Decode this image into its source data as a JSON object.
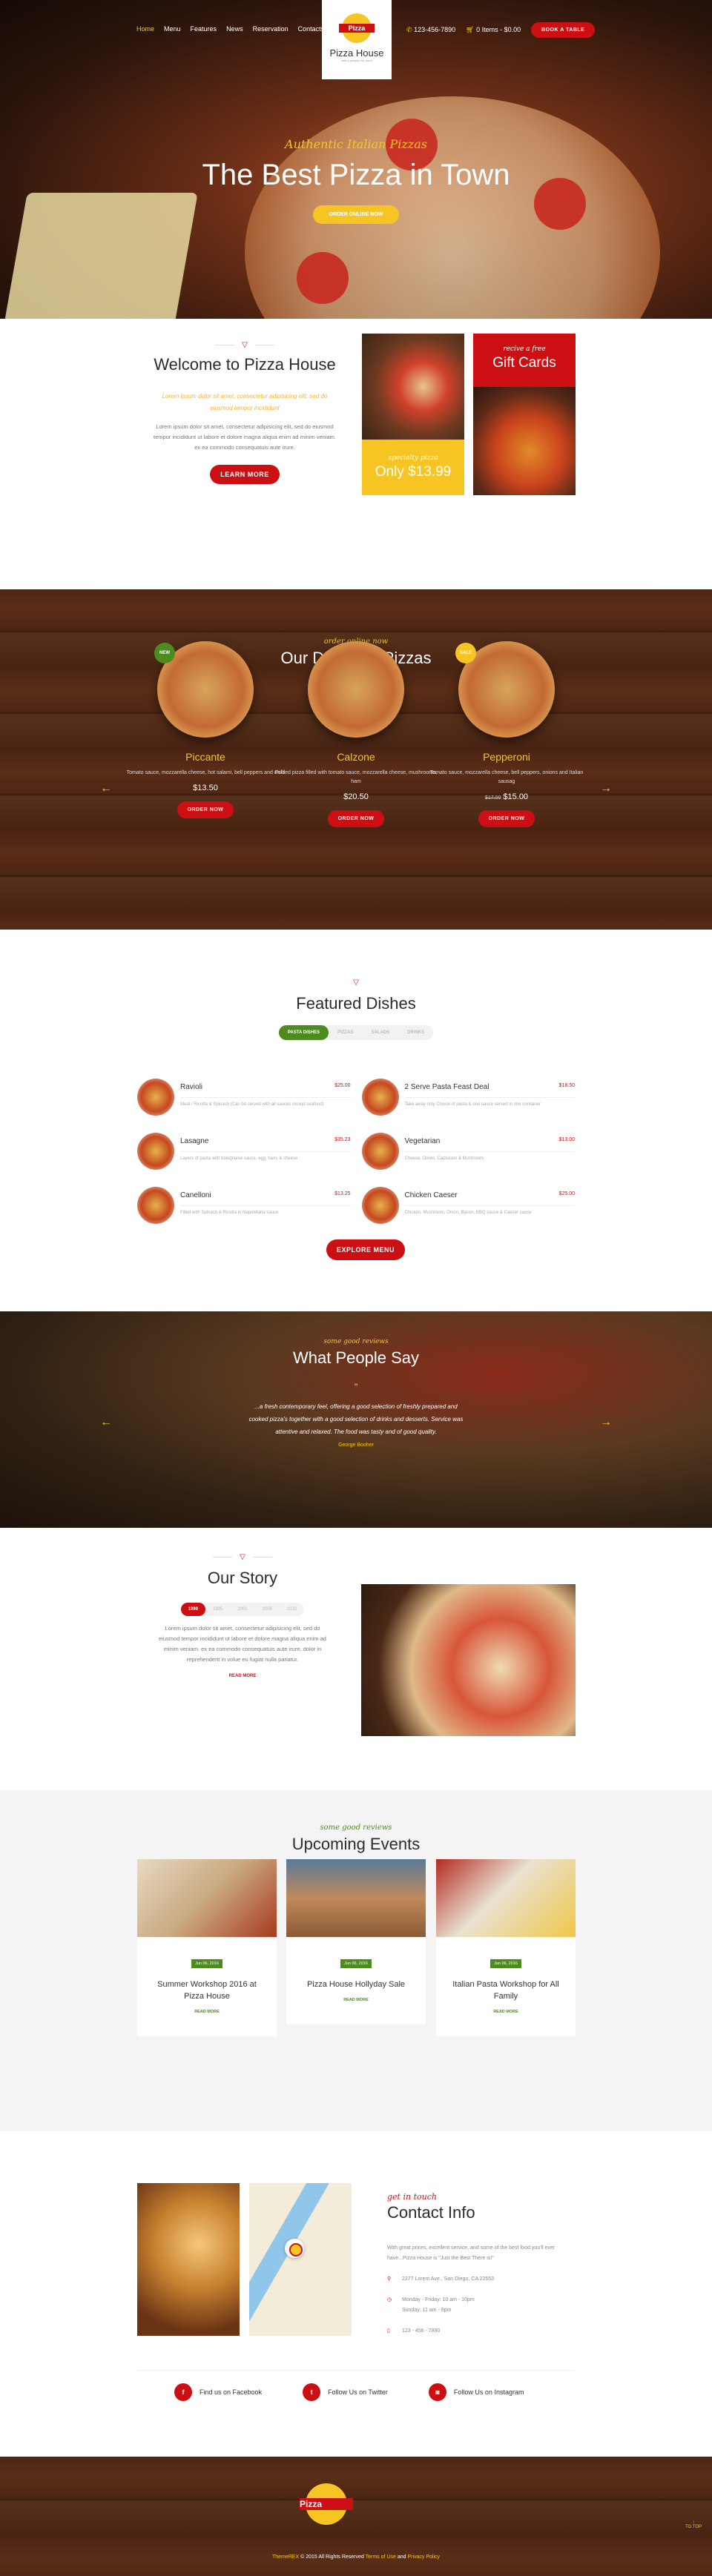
{
  "header": {
    "nav": [
      "Home",
      "Menu",
      "Features",
      "News",
      "Reservation",
      "Contacts"
    ],
    "active_nav": "Home",
    "logo_text": "Pizza",
    "brand": "Pizza House",
    "tagline": "with a passion for pizza",
    "phone": "123-456-7890",
    "cart": "0 Items - $0.00",
    "book_label": "Book a Table"
  },
  "hero": {
    "subtitle": "Authentic Italian Pizzas",
    "title": "The Best Pizza in Town",
    "cta": "Order Online Now"
  },
  "welcome": {
    "title": "Welcome to Pizza House",
    "lead": "Lorem ipsum dolor sit amet, consectetur adipisicing elit, sed do eiusmod tempor incididunt",
    "body": "Lorem ipsum dolor sit amet, consectetur adipisicing elit, sed do eiusmod tempor incididunt ut labore et dolore magna aliqua enim ad minim veniam.  ex ea commodo consequatuis aute irure.",
    "cta": "Learn More",
    "promo1": {
      "small": "specialty pizza",
      "big": "Only $13.99"
    },
    "promo2": {
      "small": "recive a free",
      "big": "Gift Cards"
    }
  },
  "pizzas": {
    "subtitle": "order online now",
    "title": "Our Delicious Pizzas",
    "items": [
      {
        "name": "Piccante",
        "desc": "Tomato sauce, mozzarella cheese, hot salami, bell peppers and chilli",
        "price": "$13.50",
        "old_price": "",
        "badge": "NEW",
        "badge_color": "#4e8b1f",
        "cta": "Order Now"
      },
      {
        "name": "Calzone",
        "desc": "Folded pizza filled with tomato sauce, mozzarella cheese, mushrooms, ham",
        "price": "$20.50",
        "old_price": "",
        "badge": "",
        "cta": "Order Now"
      },
      {
        "name": "Pepperoni",
        "desc": "Tomato sauce, mozzarella cheese, bell peppers, onions and Italian sausag",
        "price": "$15.00",
        "old_price": "$17.00",
        "badge": "SALE",
        "badge_color": "#f6c524",
        "cta": "Order Now"
      }
    ]
  },
  "featured": {
    "title": "Featured Dishes",
    "tabs": [
      "Pasta Dishes",
      "Pizzas",
      "Salads",
      "Drinks"
    ],
    "active_tab": "Pasta Dishes",
    "dishes": [
      {
        "name": "Ravioli",
        "price": "$25.00",
        "desc": "Meat / Ricotta & Spinach (Can be served with all sauces except seafood)"
      },
      {
        "name": "2 Serve Pasta Feast Deal",
        "price": "$18.50",
        "desc": "Take away only Choice of pasta & one sauce served in one container"
      },
      {
        "name": "Lasagne",
        "price": "$35.23",
        "desc": "Layers of pasta with bolognaise sauce, egg, ham, & cheese"
      },
      {
        "name": "Vegetarian",
        "price": "$13.00",
        "desc": "Cheese, Olives, Capsicum & Mushroom"
      },
      {
        "name": "Canelloni",
        "price": "$13.25",
        "desc": "Filled with Spinach & Ricotta in Napoletana sauce"
      },
      {
        "name": "Chicken Caeser",
        "price": "$25.00",
        "desc": "Chicken, Mushroom, Onion, Bacon, BBQ sauce & Caeser sauce"
      }
    ],
    "cta": "Explore Menu"
  },
  "testimonials": {
    "subtitle": "some good reviews",
    "title": "What People Say",
    "quote": "...a fresh contemporary feel, offering a good selection of freshly prepared and cooked pizza's together with a good selection of drinks and desserts. Service was attentive and relaxed. The food was tasty and of good quality.",
    "author": "George Booher"
  },
  "story": {
    "title": "Our Story",
    "years": [
      "1990",
      "1995",
      "2001",
      "2005",
      "2010"
    ],
    "active_year": "1990",
    "body": "Lorem ipsum dolor sit amet, consectetur adipisicing elit, sed do eiusmod tempor incididunt ut labore et dolore magna aliqua enim ad minim veniam.  ex ea commodo consequatuis aute irure. dolor in reprehenderit in volue eu fugiat nulla pariatur.",
    "cta": "Read More"
  },
  "events": {
    "subtitle": "some good reviews",
    "title": "Upcoming Events",
    "items": [
      {
        "date": "Jun 06, 2016",
        "title": "Summer Workshop 2016 at Pizza House",
        "cta": "Read More"
      },
      {
        "date": "Jun 06, 2016",
        "title": "Pizza House Hollyday Sale",
        "cta": "Read More"
      },
      {
        "date": "Jun 06, 2016",
        "title": "Italian Pasta Workshop for All Family",
        "cta": "Read More"
      }
    ]
  },
  "contact": {
    "subtitle": "get in touch",
    "title": "Contact Info",
    "intro": "With great prices, excellent service, and some of the best food you'll ever have...Pizza House is \"Just the Best There is!\"",
    "address": "2277 Lorem Ave., San Diego, CA 22553",
    "hours1": "Monday - Friday: 10 am - 10pm",
    "hours2": "Sunday: 11 am - 9pm",
    "phone": "123 - 456 - 7890",
    "social": [
      {
        "icon": "f",
        "label": "Find us on Facebook"
      },
      {
        "icon": "t",
        "label": "Follow Us on Twitter"
      },
      {
        "icon": "◙",
        "label": "Follow Us on Instagram"
      }
    ]
  },
  "footer": {
    "logo_text": "Pizza",
    "brand": "ThemeREX",
    "copyright": "© 2015 All Rights Reserved",
    "terms": "Terms of Use",
    "and": "and",
    "privacy": "Privacy Policy",
    "to_top": "TO TOP"
  },
  "colors": {
    "red": "#cc0f12",
    "yellow": "#f6c524",
    "green": "#4e8b1f",
    "wood": "#4a2413"
  }
}
